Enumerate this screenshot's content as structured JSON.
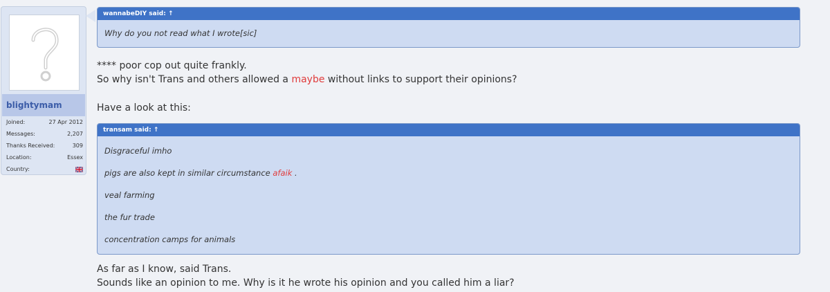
{
  "user": {
    "username": "blightymam",
    "stats": [
      {
        "label": "Joined:",
        "value": "27 Apr 2012"
      },
      {
        "label": "Messages:",
        "value": "2,207"
      },
      {
        "label": "Thanks Received:",
        "value": "309"
      },
      {
        "label": "Location:",
        "value": "Essex"
      },
      {
        "label": "Country:",
        "value": ""
      }
    ],
    "country_flag_icon": "uk-flag-icon"
  },
  "quote1": {
    "header": "wannabeDIY said: ↑",
    "text": "Why do you not read what I wrote[sic]"
  },
  "paragraph1": {
    "line1": "**** poor cop out quite frankly.",
    "line2_before": "So why isn't Trans and others allowed a ",
    "line2_highlight": "maybe",
    "line2_after": " without links to support their opinions?"
  },
  "paragraph2": "Have a look at this:",
  "quote2": {
    "header": "transam said: ↑",
    "line1": "Disgraceful imho",
    "line2_before": "pigs are also kept in similar circumstance ",
    "line2_highlight": "afaik",
    "line2_after": " .",
    "line3": "veal farming",
    "line4": "the fur trade",
    "line5": "concentration camps for animals"
  },
  "paragraph3": {
    "line1": "As far as I know, said Trans.",
    "line2": "Sounds like an opinion to me. Why is it he wrote his opinion and you called him a liar?"
  },
  "colors": {
    "quote_header": "#3f73c7",
    "quote_body": "#cedbf2",
    "highlight": "#e03b3b",
    "username": "#3b5ca8"
  }
}
